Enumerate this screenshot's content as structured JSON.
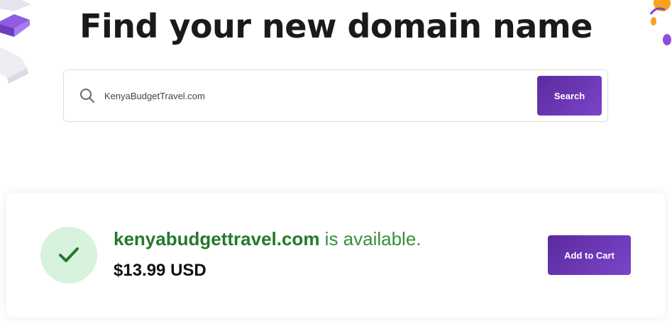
{
  "hero": {
    "title": "Find your new domain name"
  },
  "search": {
    "value": "KenyaBudgetTravel.com",
    "button_label": "Search",
    "icon": "search-icon"
  },
  "result": {
    "domain": "kenyabudgettravel.com",
    "status_text": " is available.",
    "price": "$13.99 USD",
    "cart_button_label": "Add to Cart",
    "status_icon": "checkmark-icon"
  },
  "colors": {
    "accent": "#6a36b8",
    "success": "#237a2c",
    "success_bg": "#d7f2dd"
  }
}
